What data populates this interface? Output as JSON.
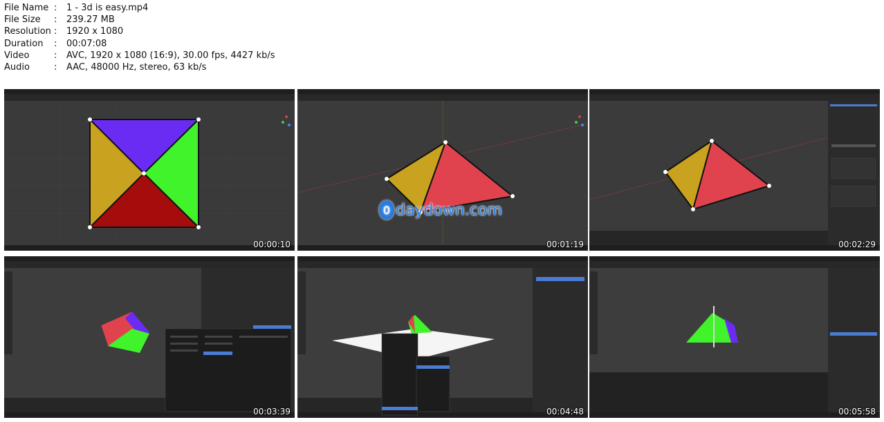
{
  "info": [
    {
      "key": "File Name",
      "value": "1 - 3d is easy.mp4"
    },
    {
      "key": "File Size",
      "value": "239.27 MB"
    },
    {
      "key": "Resolution",
      "value": "1920 x 1080"
    },
    {
      "key": "Duration",
      "value": "00:07:08"
    },
    {
      "key": "Video",
      "value": "AVC, 1920 x 1080 (16:9), 30.00 fps, 4427 kb/s"
    },
    {
      "key": "Audio",
      "value": "AAC, 48000 Hz, stereo, 63 kb/s"
    }
  ],
  "separator": ":",
  "thumbnails": [
    {
      "timestamp": "00:00:10",
      "scene": "square-triangles"
    },
    {
      "timestamp": "00:01:19",
      "scene": "pyramid-perspective"
    },
    {
      "timestamp": "00:02:29",
      "scene": "pyramid-panels"
    },
    {
      "timestamp": "00:03:39",
      "scene": "modifier-menu"
    },
    {
      "timestamp": "00:04:48",
      "scene": "add-menu-plane"
    },
    {
      "timestamp": "00:05:58",
      "scene": "pose-mode"
    }
  ],
  "watermark": {
    "text": "daydown.com",
    "icon_glyph": "0"
  },
  "colors": {
    "viewport": "#303030",
    "header": "#232323",
    "blue_face": "#6a2cf3",
    "green_face": "#41f32b",
    "yellow_face": "#c9a21f",
    "red_face": "#e0434e",
    "dark_red_face": "#a50d0d",
    "accent": "#4a7cd4"
  }
}
